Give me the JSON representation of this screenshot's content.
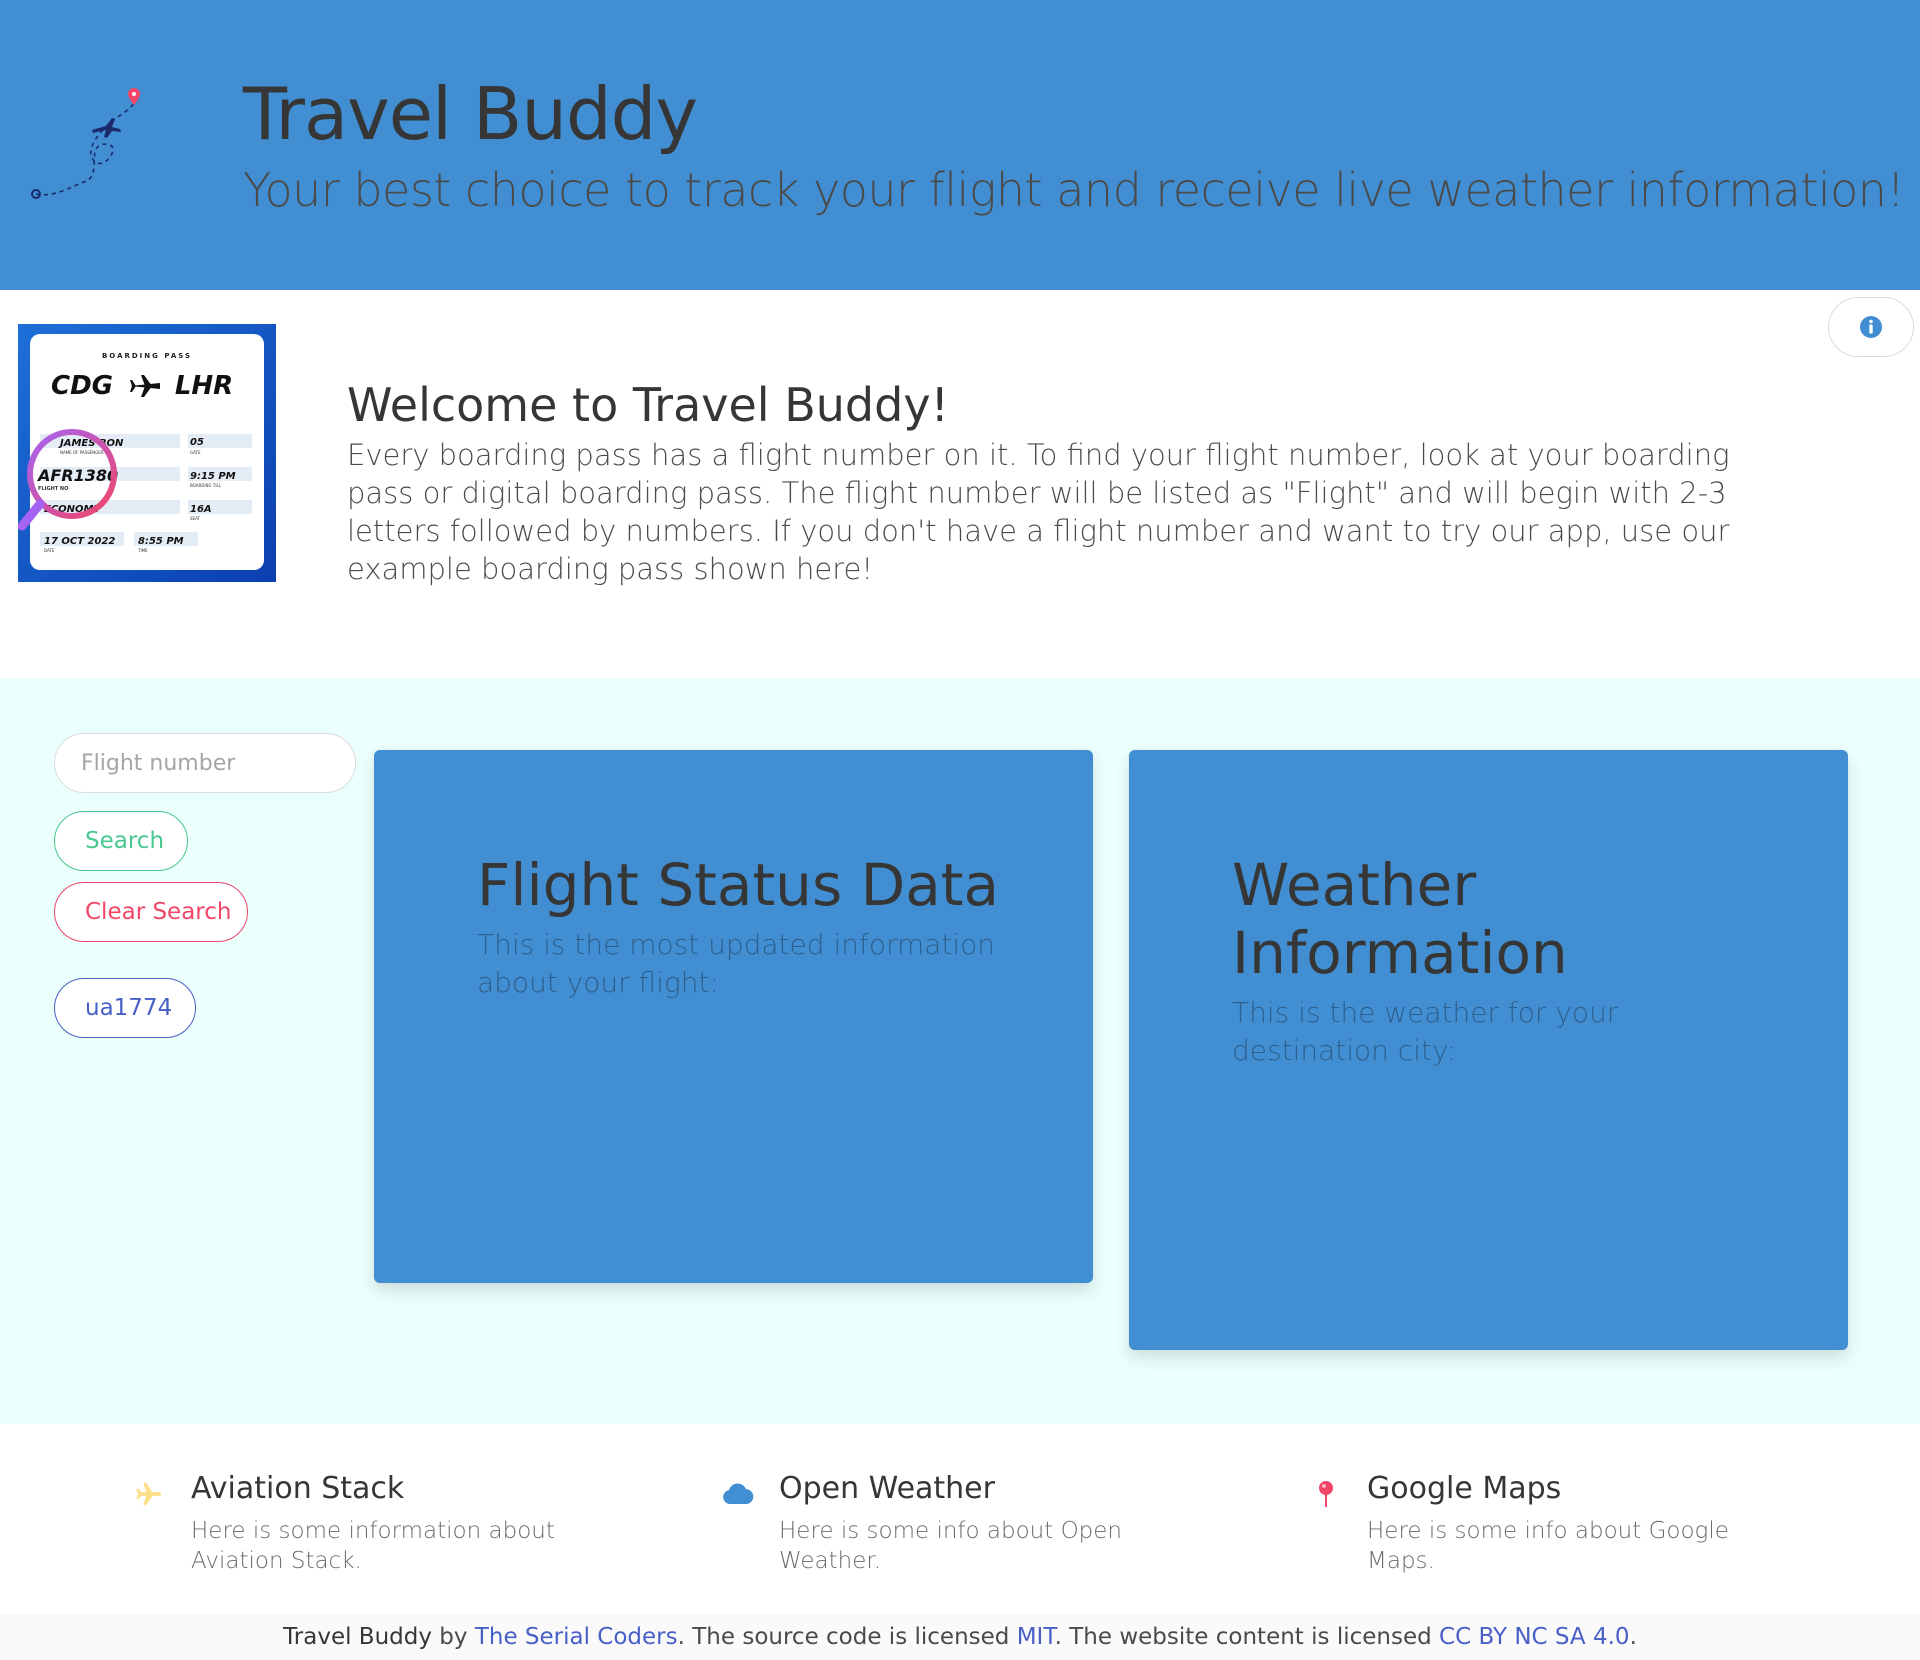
{
  "hero": {
    "title": "Travel Buddy",
    "subtitle": "Your best choice to track your flight and receive live weather information!",
    "logo_icon": "plane-route-icon",
    "background": "#418fd2"
  },
  "welcome": {
    "title": "Welcome to Travel Buddy!",
    "text": "Every boarding pass has a flight number on it. To find your flight number, look at your boarding pass or digital boarding pass. The flight number will be listed as \"Flight\" and will begin with 2-3 letters followed by numbers. If you don't have a flight number and want to try our app, use our example boarding pass shown here!",
    "info_icon": "info-circle-icon",
    "boarding_pass": {
      "heading": "BOARDING PASS",
      "from": "CDG",
      "to": "LHR",
      "passenger": "JAMES BON",
      "passenger_label": "NAME OF PASSENGER",
      "gate": "05",
      "gate_label": "GATE",
      "flight_no": "AFR1380",
      "flight_label": "FLIGHT NO",
      "boarding_time": "9:15 PM",
      "boarding_label": "BOARDING TILL",
      "class": "ECONOMY",
      "class_label": "CLASS",
      "seat": "16A",
      "seat_label": "SEAT",
      "date": "17 OCT 2022",
      "date_label": "DATE",
      "time": "8:55 PM",
      "time_label": "TIME"
    }
  },
  "search": {
    "placeholder": "Flight number",
    "value": "",
    "search_label": "Search",
    "clear_label": "Clear Search",
    "history": [
      "ua1774"
    ]
  },
  "cards": {
    "flight": {
      "title": "Flight Status Data",
      "subtitle": "This is the most updated information about your flight:"
    },
    "weather": {
      "title": "Weather Information",
      "subtitle": "This is the weather for your destination city:"
    }
  },
  "resources": [
    {
      "icon": "plane-icon",
      "icon_color": "#ffe08a",
      "title": "Aviation Stack",
      "text": "Here is some information about Aviation Stack."
    },
    {
      "icon": "cloud-icon",
      "icon_color": "#418fd2",
      "title": "Open Weather",
      "text": "Here is some info about Open Weather."
    },
    {
      "icon": "map-pin-icon",
      "icon_color": "#f14668",
      "title": "Google Maps",
      "text": "Here is some info about Google Maps."
    }
  ],
  "footer": {
    "brand": "Travel Buddy",
    "by": " by ",
    "team": "The Serial Coders",
    "code_text": ". The source code is licensed ",
    "code_license": "MIT",
    "content_text": ". The website content is licensed ",
    "content_license": "CC BY NC SA 4.0",
    "end": "."
  }
}
